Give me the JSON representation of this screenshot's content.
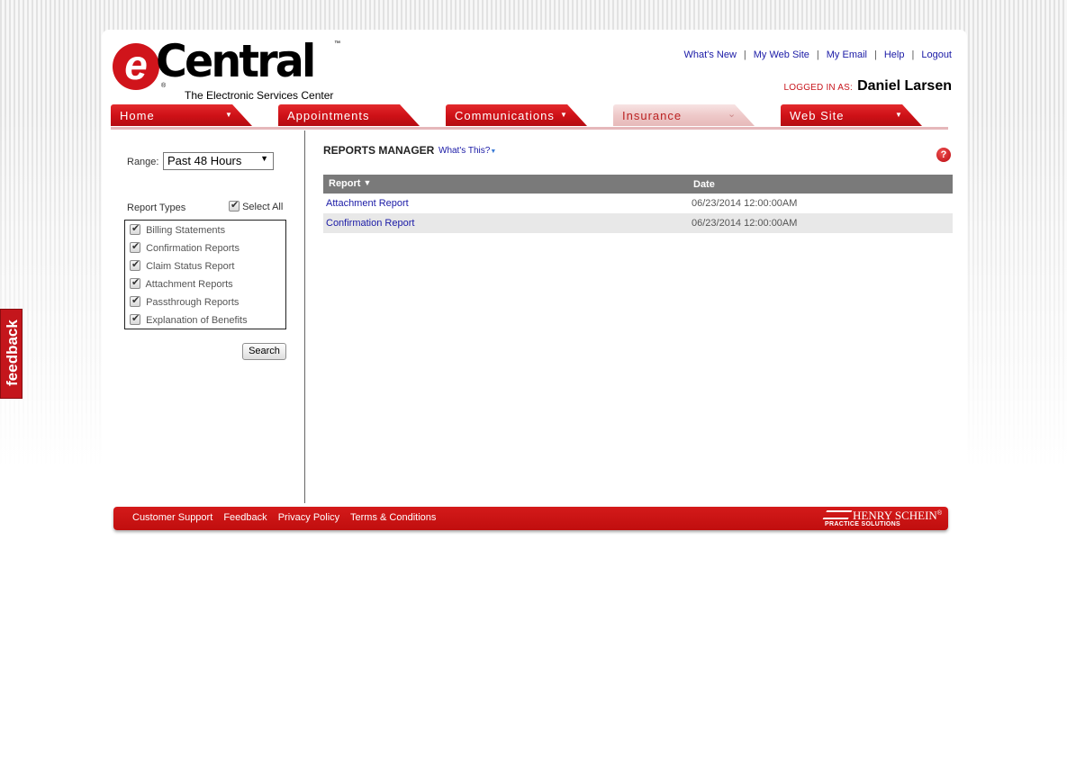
{
  "logo": {
    "e_letter": "e",
    "name": "Central",
    "trademark": "™",
    "registered": "®",
    "tagline": "The Electronic Services Center"
  },
  "toplinks": [
    "What's New",
    "My Web Site",
    "My Email",
    "Help",
    "Logout"
  ],
  "separator": "|",
  "user": {
    "logged_label": "LOGGED IN AS:",
    "name": "Daniel Larsen"
  },
  "nav": {
    "tabs": [
      {
        "label": "Home",
        "arrow": "▼",
        "active": true
      },
      {
        "label": "Appointments",
        "arrow": "",
        "active": true
      },
      {
        "label": "Communications",
        "arrow": "▼",
        "active": true
      },
      {
        "label": "Insurance",
        "arrow": "⌄",
        "active": false
      },
      {
        "label": "Web Site",
        "arrow": "▼",
        "active": true
      }
    ]
  },
  "filters": {
    "range_label": "Range:",
    "range_value": "Past 48 Hours",
    "report_types_label": "Report Types",
    "select_all_label": "Select All",
    "types": [
      "Billing Statements",
      "Confirmation Reports",
      "Claim Status Report",
      "Attachment Reports",
      "Passthrough Reports",
      "Explanation of Benefits"
    ],
    "search_label": "Search"
  },
  "reports": {
    "title": "REPORTS MANAGER",
    "whats_this": "What's This?",
    "help_glyph": "?",
    "columns": [
      "Report",
      "Date"
    ],
    "sort_glyph": "▼",
    "rows": [
      {
        "report": "Attachment Report",
        "date": "06/23/2014 12:00:00AM"
      },
      {
        "report": "Confirmation Report",
        "date": "06/23/2014 12:00:00AM"
      }
    ]
  },
  "footer": {
    "links": [
      "Customer Support",
      "Feedback",
      "Privacy Policy",
      "Terms & Conditions"
    ],
    "brand_name": "HENRY SCHEIN",
    "brand_reg": "®",
    "brand_sub": "PRACTICE SOLUTIONS"
  },
  "feedback_tab": "feedback",
  "colors": {
    "brand_red": "#cf1117",
    "link_blue": "#1a1aa6",
    "table_header": "#7a7a7a",
    "row_alt": "#e8e8e8"
  }
}
